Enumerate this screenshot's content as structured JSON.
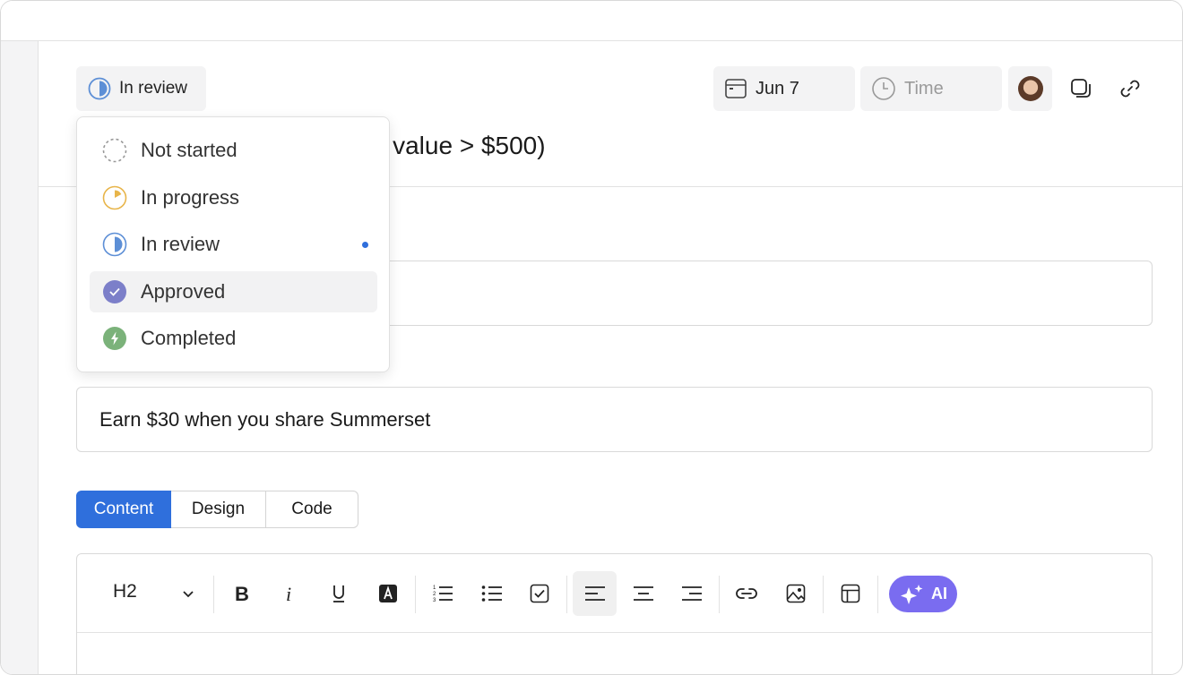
{
  "status": {
    "label": "In review"
  },
  "toolbar_top": {
    "date": "Jun 7",
    "time_placeholder": "Time"
  },
  "title_visible": "r value > $500)",
  "status_menu": {
    "items": [
      {
        "label": "Not started",
        "icon": "dashed-circle-icon"
      },
      {
        "label": "In progress",
        "icon": "progress-circle-icon"
      },
      {
        "label": "In review",
        "icon": "half-circle-icon",
        "selected": true
      },
      {
        "label": "Approved",
        "icon": "check-circle-icon"
      },
      {
        "label": "Completed",
        "icon": "bolt-circle-icon"
      }
    ]
  },
  "field2": {
    "value": "Earn $30 when you share Summerset"
  },
  "tabs": [
    {
      "label": "Content",
      "active": true
    },
    {
      "label": "Design"
    },
    {
      "label": "Code"
    }
  ],
  "editor": {
    "heading_select": "H2",
    "ai_label": "AI",
    "tools": [
      "bold",
      "italic",
      "underline",
      "text-color",
      "ordered-list",
      "bullet-list",
      "checklist",
      "align-left",
      "align-center",
      "align-right",
      "link",
      "image",
      "table"
    ]
  },
  "colors": {
    "accent": "#2f6fdc",
    "ai": "#7a6cf0",
    "in_progress": "#e8b54a",
    "in_review": "#5d8fd6",
    "approved": "#7c7fc9",
    "completed": "#7bb27a"
  }
}
